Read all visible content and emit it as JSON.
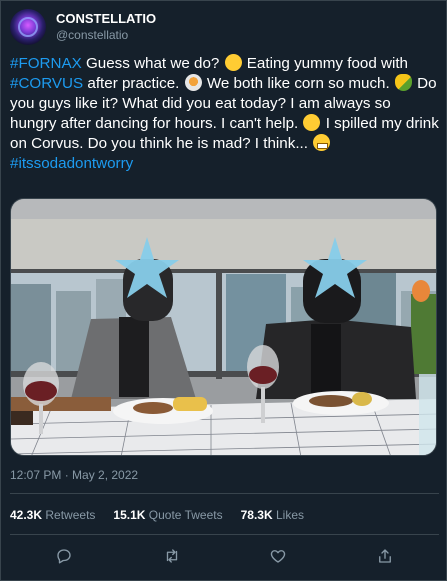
{
  "user": {
    "display_name": "CONSTELLATIO",
    "handle": "@constellatio",
    "avatar_icon": "constellation-avatar-icon"
  },
  "tweet": {
    "segments": [
      {
        "type": "hashtag",
        "text": "#FORNAX"
      },
      {
        "type": "text",
        "text": " Guess what we do? "
      },
      {
        "type": "emoji",
        "icon": "yum-face-icon"
      },
      {
        "type": "text",
        "text": " Eating yummy food with "
      },
      {
        "type": "hashtag",
        "text": "#CORVUS"
      },
      {
        "type": "text",
        "text": " after practice. "
      },
      {
        "type": "emoji",
        "icon": "spaghetti-icon"
      },
      {
        "type": "text",
        "text": " We both like corn so much. "
      },
      {
        "type": "emoji",
        "icon": "corn-icon"
      },
      {
        "type": "text",
        "text": " Do you guys like it? What did you eat today? I am always so hungry after dancing for hours. I can't help. "
      },
      {
        "type": "emoji",
        "icon": "zany-face-icon"
      },
      {
        "type": "text",
        "text": " I spilled my drink on Corvus. Do you think he is mad? I think... "
      },
      {
        "type": "emoji",
        "icon": "grimacing-face-icon"
      },
      {
        "type": "text",
        "text": " "
      },
      {
        "type": "hashtag",
        "text": "#itssodadontworry"
      }
    ],
    "timestamp": "12:07 PM · May 2, 2022"
  },
  "stats": {
    "retweets_count": "42.3K",
    "retweets_label": "Retweets",
    "quote_count": "15.1K",
    "quote_label": "Quote Tweets",
    "likes_count": "78.3K",
    "likes_label": "Likes"
  },
  "actions": [
    {
      "icon": "reply-icon"
    },
    {
      "icon": "retweet-icon"
    },
    {
      "icon": "like-heart-icon"
    },
    {
      "icon": "share-icon"
    }
  ],
  "colors": {
    "background": "#15202b",
    "accent": "#1d9bf0",
    "secondary_text": "#8899a6",
    "border": "#38444d",
    "star_overlay": "#87cdea"
  }
}
